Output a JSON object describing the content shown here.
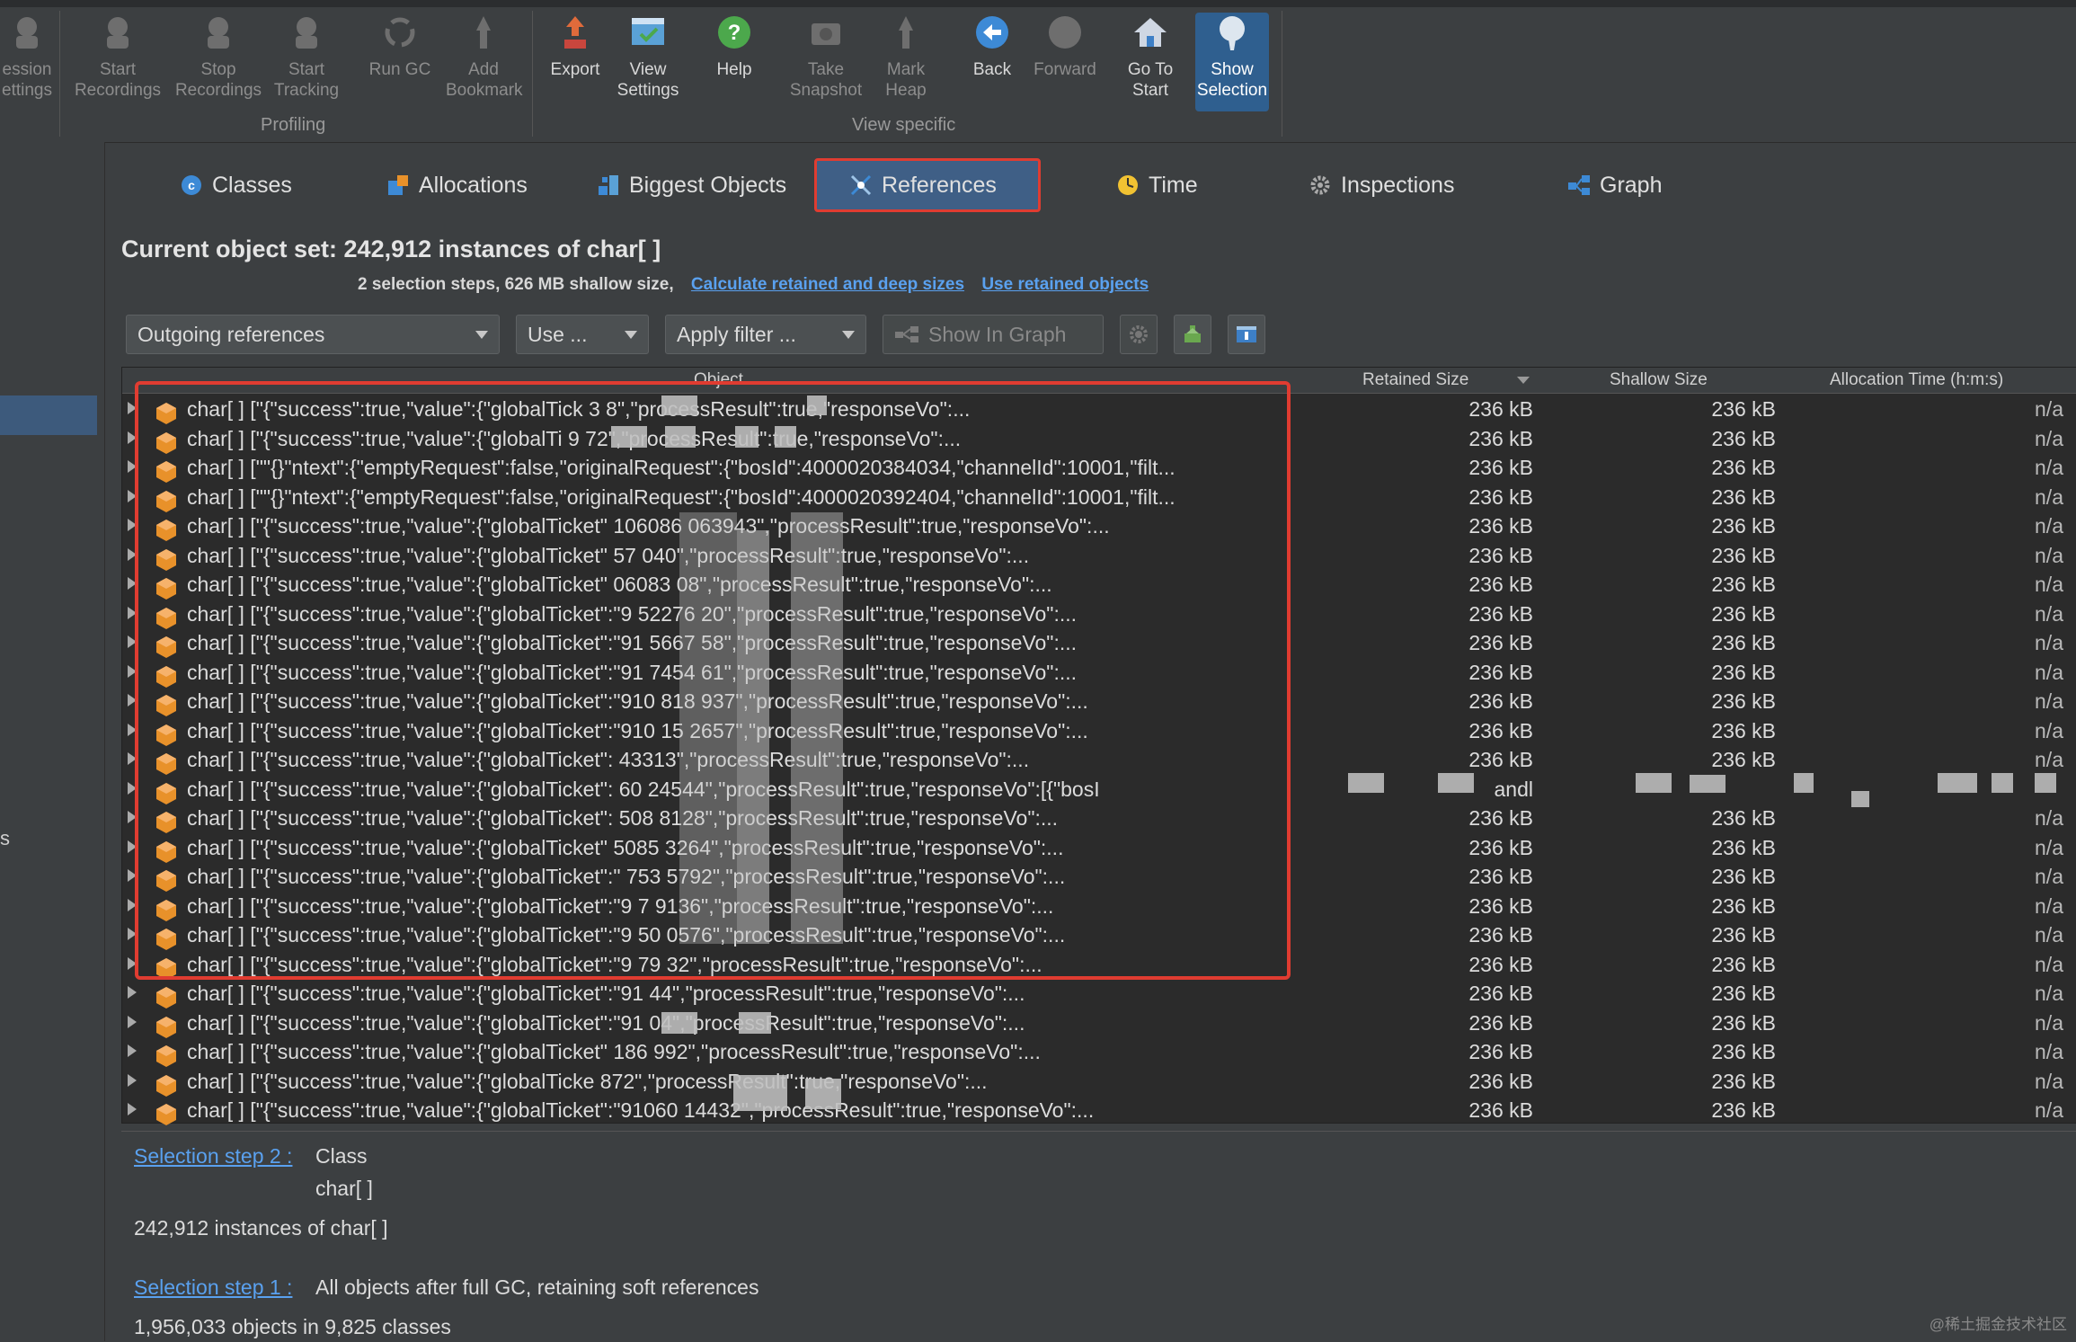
{
  "toolbar": {
    "groups": {
      "profiling": "Profiling",
      "view_specific": "View specific"
    },
    "buttons": [
      {
        "label": "ession\nettings",
        "icon": "session-settings-icon",
        "enabled": false
      },
      {
        "label": "Start\nRecordings",
        "icon": "start-recordings-icon",
        "enabled": false
      },
      {
        "label": "Stop\nRecordings",
        "icon": "stop-recordings-icon",
        "enabled": false
      },
      {
        "label": "Start\nTracking",
        "icon": "start-tracking-icon",
        "enabled": false
      },
      {
        "label": "Run GC",
        "icon": "run-gc-icon",
        "enabled": false
      },
      {
        "label": "Add\nBookmark",
        "icon": "add-bookmark-icon",
        "enabled": false
      },
      {
        "label": "Export",
        "icon": "export-icon",
        "enabled": true
      },
      {
        "label": "View\nSettings",
        "icon": "view-settings-icon",
        "enabled": true
      },
      {
        "label": "Help",
        "icon": "help-icon",
        "enabled": true
      },
      {
        "label": "Take\nSnapshot",
        "icon": "take-snapshot-icon",
        "enabled": false
      },
      {
        "label": "Mark\nHeap",
        "icon": "mark-heap-icon",
        "enabled": false
      },
      {
        "label": "Back",
        "icon": "back-icon",
        "enabled": true
      },
      {
        "label": "Forward",
        "icon": "forward-icon",
        "enabled": false
      },
      {
        "label": "Go To\nStart",
        "icon": "go-to-start-icon",
        "enabled": true
      },
      {
        "label": "Show\nSelection",
        "icon": "show-selection-icon",
        "enabled": true,
        "active": true
      }
    ]
  },
  "left": {
    "fragment": "s"
  },
  "tabs": [
    {
      "label": "Classes",
      "icon": "classes-icon",
      "active": false
    },
    {
      "label": "Allocations",
      "icon": "allocations-icon",
      "active": false
    },
    {
      "label": "Biggest Objects",
      "icon": "biggest-objects-icon",
      "active": false
    },
    {
      "label": "References",
      "icon": "references-icon",
      "active": true
    },
    {
      "label": "Time",
      "icon": "time-icon",
      "active": false
    },
    {
      "label": "Inspections",
      "icon": "inspections-icon",
      "active": false
    },
    {
      "label": "Graph",
      "icon": "graph-icon",
      "active": false
    }
  ],
  "header": {
    "title": "Current object set:  242,912 instances of char[ ]",
    "steps_info": "2 selection steps, 626 MB shallow size,",
    "link_calc": "Calculate retained and deep sizes",
    "link_use": "Use retained objects"
  },
  "controls": {
    "references_mode": "Outgoing references",
    "use": "Use ...",
    "apply_filter": "Apply filter ...",
    "show_in_graph": "Show In Graph"
  },
  "table": {
    "columns": {
      "object": "Object",
      "retained": "Retained Size",
      "shallow": "Shallow Size",
      "allocation": "Allocation Time (h:m:s)"
    },
    "rows": [
      {
        "text": "char[ ] [\"{\"success\":true,\"value\":{\"globalTick                    3      8\",\"processResult\":true,\"responseVo\":...",
        "retained": "236 kB",
        "shallow": "236 kB",
        "alloc": "n/a"
      },
      {
        "text": "char[ ] [\"{\"success\":true,\"value\":{\"globalTi                    9   72\",\"processResult\":true,\"responseVo\":...",
        "retained": "236 kB",
        "shallow": "236 kB",
        "alloc": "n/a"
      },
      {
        "text": "char[ ] [\"\"{}\"ntext\":{\"emptyRequest\":false,\"originalRequest\":{\"bosId\":4000020384034,\"channelId\":10001,\"filt...",
        "retained": "236 kB",
        "shallow": "236 kB",
        "alloc": "n/a"
      },
      {
        "text": "char[ ] [\"\"{}\"ntext\":{\"emptyRequest\":false,\"originalRequest\":{\"bosId\":4000020392404,\"channelId\":10001,\"filt...",
        "retained": "236 kB",
        "shallow": "236 kB",
        "alloc": "n/a"
      },
      {
        "text": "char[ ] [\"{\"success\":true,\"value\":{\"globalTicket\"    106086       063943\",\"processResult\":true,\"responseVo\":...",
        "retained": "236 kB",
        "shallow": "236 kB",
        "alloc": "n/a"
      },
      {
        "text": "char[ ] [\"{\"success\":true,\"value\":{\"globalTicket\"     57          040\",\"processResult\":true,\"responseVo\":...",
        "retained": "236 kB",
        "shallow": "236 kB",
        "alloc": "n/a"
      },
      {
        "text": "char[ ] [\"{\"success\":true,\"value\":{\"globalTicket\"      06083      08\",\"processResult\":true,\"responseVo\":...",
        "retained": "236 kB",
        "shallow": "236 kB",
        "alloc": "n/a"
      },
      {
        "text": "char[ ] [\"{\"success\":true,\"value\":{\"globalTicket\":\"9         52276     20\",\"processResult\":true,\"responseVo\":...",
        "retained": "236 kB",
        "shallow": "236 kB",
        "alloc": "n/a"
      },
      {
        "text": "char[ ] [\"{\"success\":true,\"value\":{\"globalTicket\":\"91         5667      58\",\"processResult\":true,\"responseVo\":...",
        "retained": "236 kB",
        "shallow": "236 kB",
        "alloc": "n/a"
      },
      {
        "text": "char[ ] [\"{\"success\":true,\"value\":{\"globalTicket\":\"91         7454      61\",\"processResult\":true,\"responseVo\":...",
        "retained": "236 kB",
        "shallow": "236 kB",
        "alloc": "n/a"
      },
      {
        "text": "char[ ] [\"{\"success\":true,\"value\":{\"globalTicket\":\"910        818       937\",\"processResult\":true,\"responseVo\":...",
        "retained": "236 kB",
        "shallow": "236 kB",
        "alloc": "n/a"
      },
      {
        "text": "char[ ] [\"{\"success\":true,\"value\":{\"globalTicket\":\"910        15      2657\",\"processResult\":true,\"responseVo\":...",
        "retained": "236 kB",
        "shallow": "236 kB",
        "alloc": "n/a"
      },
      {
        "text": "char[ ] [\"{\"success\":true,\"value\":{\"globalTicket\":               43313\",\"processResult\":true,\"responseVo\":...",
        "retained": "236 kB",
        "shallow": "236 kB",
        "alloc": "n/a"
      },
      {
        "text": "char[ ] [\"{\"success\":true,\"value\":{\"globalTicket\":     60       24544\",\"processResult\":true,\"responseVo\":[{\"bosI",
        "retained": "andl",
        "shallow": "",
        "alloc": ""
      },
      {
        "text": "char[ ] [\"{\"success\":true,\"value\":{\"globalTicket\":    508         8128\",\"processResult\":true,\"responseVo\":...",
        "retained": "236 kB",
        "shallow": "236 kB",
        "alloc": "n/a"
      },
      {
        "text": "char[ ] [\"{\"success\":true,\"value\":{\"globalTicket\"    5085        3264\",\"processResult\":true,\"responseVo\":...",
        "retained": "236 kB",
        "shallow": "236 kB",
        "alloc": "n/a"
      },
      {
        "text": "char[ ] [\"{\"success\":true,\"value\":{\"globalTicket\":\"     753       5792\",\"processResult\":true,\"responseVo\":...",
        "retained": "236 kB",
        "shallow": "236 kB",
        "alloc": "n/a"
      },
      {
        "text": "char[ ] [\"{\"success\":true,\"value\":{\"globalTicket\":\"9      7          9136\",\"processResult\":true,\"responseVo\":...",
        "retained": "236 kB",
        "shallow": "236 kB",
        "alloc": "n/a"
      },
      {
        "text": "char[ ] [\"{\"success\":true,\"value\":{\"globalTicket\":\"9        50      0576\",\"processResult\":true,\"responseVo\":...",
        "retained": "236 kB",
        "shallow": "236 kB",
        "alloc": "n/a"
      },
      {
        "text": "char[ ] [\"{\"success\":true,\"value\":{\"globalTicket\":\"9        79       32\",\"processResult\":true,\"responseVo\":...",
        "retained": "236 kB",
        "shallow": "236 kB",
        "alloc": "n/a"
      },
      {
        "text": "char[ ] [\"{\"success\":true,\"value\":{\"globalTicket\":\"91                 44\",\"processResult\":true,\"responseVo\":...",
        "retained": "236 kB",
        "shallow": "236 kB",
        "alloc": "n/a"
      },
      {
        "text": "char[ ] [\"{\"success\":true,\"value\":{\"globalTicket\":\"91                 04\",\"processResult\":true,\"responseVo\":...",
        "retained": "236 kB",
        "shallow": "236 kB",
        "alloc": "n/a"
      },
      {
        "text": "char[ ] [\"{\"success\":true,\"value\":{\"globalTicket\"          186       992\",\"processResult\":true,\"responseVo\":...",
        "retained": "236 kB",
        "shallow": "236 kB",
        "alloc": "n/a"
      },
      {
        "text": "char[ ] [\"{\"success\":true,\"value\":{\"globalTicke                   872\",\"processResult\":true,\"responseVo\":...",
        "retained": "236 kB",
        "shallow": "236 kB",
        "alloc": "n/a"
      },
      {
        "text": "char[ ] [\"{\"success\":true,\"value\":{\"globalTicket\":\"91060          14432\",\"processResult\":true,\"responseVo\":...",
        "retained": "236 kB",
        "shallow": "236 kB",
        "alloc": "n/a"
      }
    ]
  },
  "details": {
    "step2_link": "Selection step 2 :",
    "step2_kind": "Class",
    "step2_class": "char[ ]",
    "step2_count": "242,912 instances of char[ ]",
    "step1_link": "Selection step 1 :",
    "step1_desc": "All objects after full GC, retaining soft references",
    "step1_count": "1,956,033 objects in 9,825 classes"
  },
  "watermark": "@稀土掘金技术社区",
  "colors": {
    "accent": "#3f5f86",
    "highlight_border": "#e03c31",
    "link": "#5aa1ef",
    "object_icon": "#e8912a"
  }
}
